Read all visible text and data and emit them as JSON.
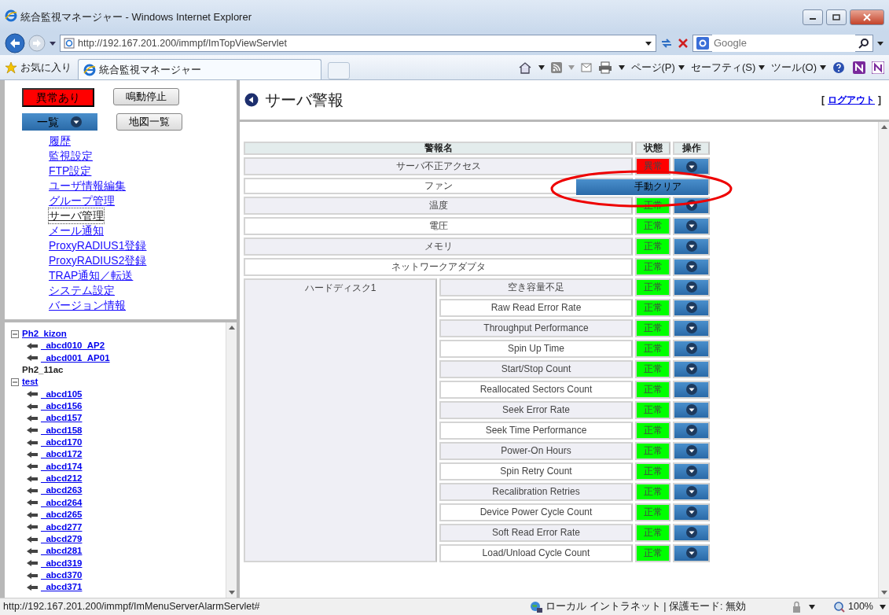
{
  "window": {
    "title": "統合監視マネージャー - Windows Internet Explorer"
  },
  "address_bar": {
    "url": "http://192.167.201.200/immpf/ImTopViewServlet"
  },
  "search_box": {
    "placeholder": "Google"
  },
  "favorites_label": "お気に入り",
  "tabs": [
    {
      "label": "統合監視マネージャー",
      "selected": true
    }
  ],
  "command_bar": [
    "ページ(P)",
    "セーフティ(S)",
    "ツール(O)"
  ],
  "sidebar": {
    "alarm_button": "異常あり",
    "stop_button": "鳴動停止",
    "view_dropdown": "一覧",
    "map_button": "地図一覧",
    "links": [
      {
        "label": "履歴",
        "focused": false
      },
      {
        "label": "監視設定",
        "focused": false
      },
      {
        "label": "FTP設定",
        "focused": false
      },
      {
        "label": "ユーザ情報編集",
        "focused": false
      },
      {
        "label": "グループ管理",
        "focused": false
      },
      {
        "label": "サーバ管理",
        "focused": true
      },
      {
        "label": "メール通知",
        "focused": false
      },
      {
        "label": "ProxyRADIUS1登録",
        "focused": false
      },
      {
        "label": "ProxyRADIUS2登録",
        "focused": false
      },
      {
        "label": "TRAP通知／転送",
        "focused": false
      },
      {
        "label": "システム設定",
        "focused": false
      },
      {
        "label": "バージョン情報",
        "focused": false
      }
    ]
  },
  "tree": [
    {
      "label": "Ph2_kizon",
      "expanded": true,
      "children": [
        {
          "label": "_abcd010_AP2"
        },
        {
          "label": "_abcd001_AP01"
        }
      ]
    },
    {
      "label": "Ph2_11ac"
    },
    {
      "label": "test",
      "expanded": true,
      "children": [
        {
          "label": "_abcd105"
        },
        {
          "label": "_abcd156"
        },
        {
          "label": "_abcd157"
        },
        {
          "label": "_abcd158"
        },
        {
          "label": "_abcd170"
        },
        {
          "label": "_abcd172"
        },
        {
          "label": "_abcd174"
        },
        {
          "label": "_abcd212"
        },
        {
          "label": "_abcd263"
        },
        {
          "label": "_abcd264"
        },
        {
          "label": "_abcd265"
        },
        {
          "label": "_abcd277"
        },
        {
          "label": "_abcd279"
        },
        {
          "label": "_abcd281"
        },
        {
          "label": "_abcd319"
        },
        {
          "label": "_abcd370"
        },
        {
          "label": "_abcd371"
        }
      ]
    }
  ],
  "page": {
    "title": "サーバ警報",
    "logout_open": "[",
    "logout_link": "ログアウト",
    "logout_close": "]"
  },
  "table": {
    "columns": [
      "警報名",
      "状態",
      "操作"
    ],
    "rows": [
      {
        "name": "サーバ不正アクセス",
        "alarm": true,
        "status_text": "異常",
        "menu_open": false
      },
      {
        "name": "ファン",
        "alarm": false,
        "menu_open": true
      },
      {
        "name": "温度",
        "alarm": false,
        "status_text": "正常",
        "menu_open": false
      },
      {
        "name": "電圧",
        "alarm": false,
        "status_text": "正常",
        "menu_open": false
      },
      {
        "name": "メモリ",
        "alarm": false,
        "status_text": "正常",
        "menu_open": false
      },
      {
        "name": "ネットワークアダプタ",
        "alarm": false,
        "status_text": "正常",
        "menu_open": false
      },
      {
        "group": "ハードディスク1",
        "children": [
          {
            "name": "空き容量不足",
            "alarm": false,
            "status_text": "正常",
            "menu_open": false
          },
          {
            "name": "Raw Read Error Rate",
            "alarm": false,
            "status_text": "正常",
            "menu_open": false
          },
          {
            "name": "Throughput Performance",
            "alarm": false,
            "status_text": "正常",
            "menu_open": false
          },
          {
            "name": "Spin Up Time",
            "alarm": false,
            "status_text": "正常",
            "menu_open": false
          },
          {
            "name": "Start/Stop Count",
            "alarm": false,
            "status_text": "正常",
            "menu_open": false
          },
          {
            "name": "Reallocated Sectors Count",
            "alarm": false,
            "status_text": "正常",
            "menu_open": false
          },
          {
            "name": "Seek Error Rate",
            "alarm": false,
            "status_text": "正常",
            "menu_open": false
          },
          {
            "name": "Seek Time Performance",
            "alarm": false,
            "status_text": "正常",
            "menu_open": false
          },
          {
            "name": "Power-On Hours",
            "alarm": false,
            "status_text": "正常",
            "menu_open": false
          },
          {
            "name": "Spin Retry Count",
            "alarm": false,
            "status_text": "正常",
            "menu_open": false
          },
          {
            "name": "Recalibration Retries",
            "alarm": false,
            "status_text": "正常",
            "menu_open": false
          },
          {
            "name": "Device Power Cycle Count",
            "alarm": false,
            "status_text": "正常",
            "menu_open": false
          },
          {
            "name": "Soft Read Error Rate",
            "alarm": false,
            "status_text": "正常",
            "menu_open": false
          },
          {
            "name": "Load/Unload Cycle Count",
            "alarm": false,
            "status_text": "正常",
            "menu_open": false
          }
        ]
      }
    ]
  },
  "popup_menu": {
    "items": [
      "手動クリア"
    ]
  },
  "status_bar": {
    "url": "http://192.167.201.200/immpf/ImMenuServerAlarmServlet#",
    "zone": "ローカル イントラネット | 保護モード: 無効",
    "zoom": "100%"
  }
}
